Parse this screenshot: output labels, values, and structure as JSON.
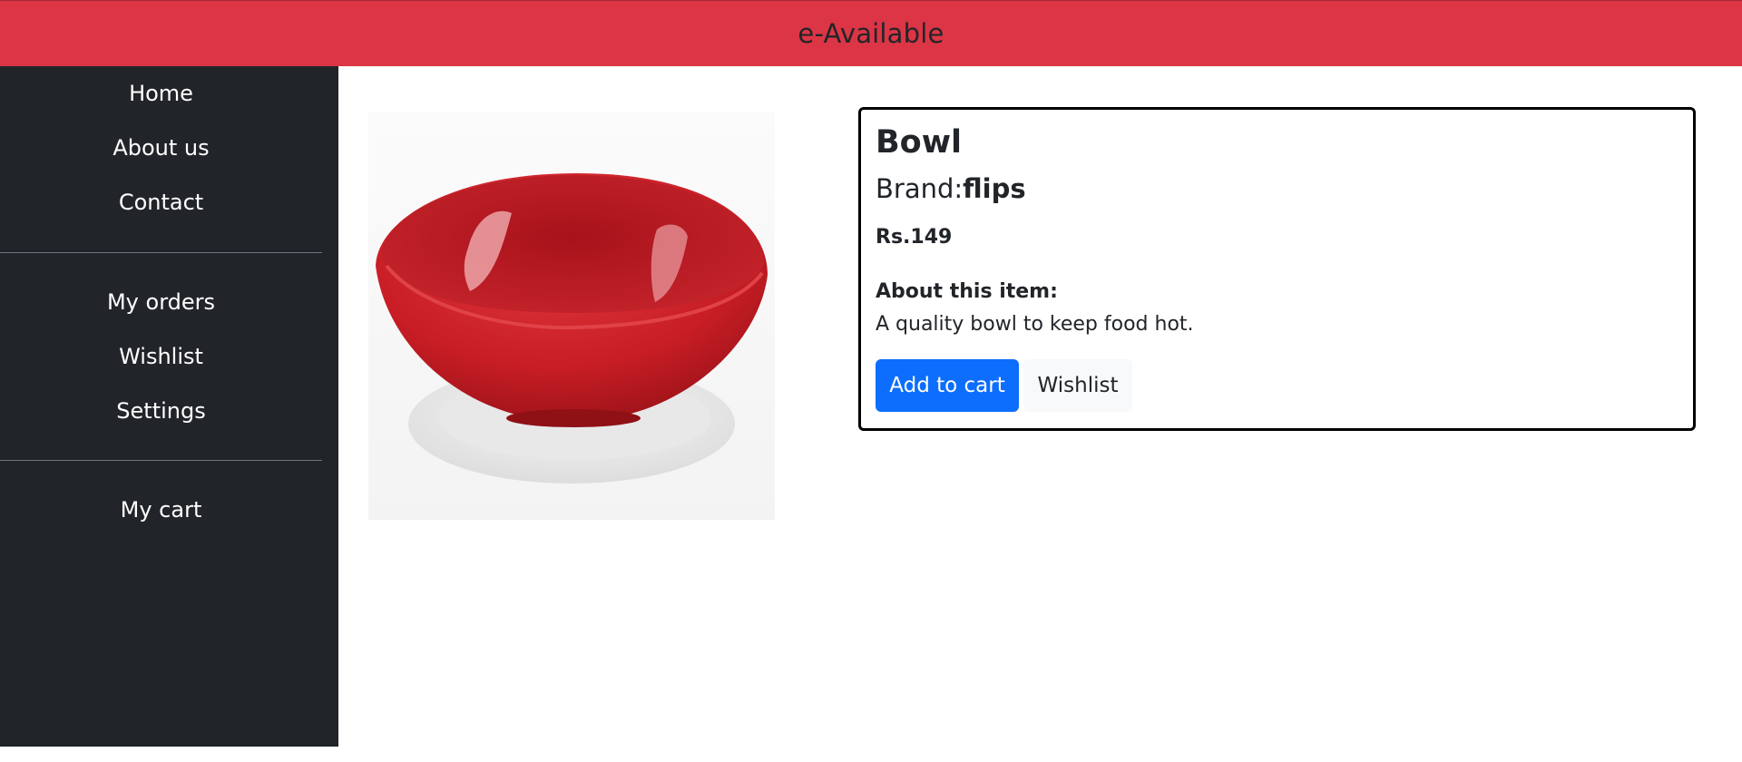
{
  "header": {
    "brand": "e-Available"
  },
  "sidebar": {
    "items": [
      {
        "label": "Home"
      },
      {
        "label": "About us"
      },
      {
        "label": "Contact"
      },
      {
        "label": "My orders"
      },
      {
        "label": "Wishlist"
      },
      {
        "label": "Settings"
      },
      {
        "label": "My cart"
      }
    ]
  },
  "product": {
    "title": "Bowl",
    "brand_label": "Brand:",
    "brand_value": "flips",
    "price": "Rs.149",
    "about_heading": "About this item:",
    "about_text": "A quality bowl to keep food hot.",
    "image_icon": "red-bowl-icon"
  },
  "actions": {
    "add_to_cart": "Add to cart",
    "wishlist": "Wishlist"
  },
  "colors": {
    "header": "#dc3545",
    "sidebar": "#212529",
    "primary": "#0d6efd",
    "light": "#f8f9fa",
    "bowl": "#c81d25"
  }
}
